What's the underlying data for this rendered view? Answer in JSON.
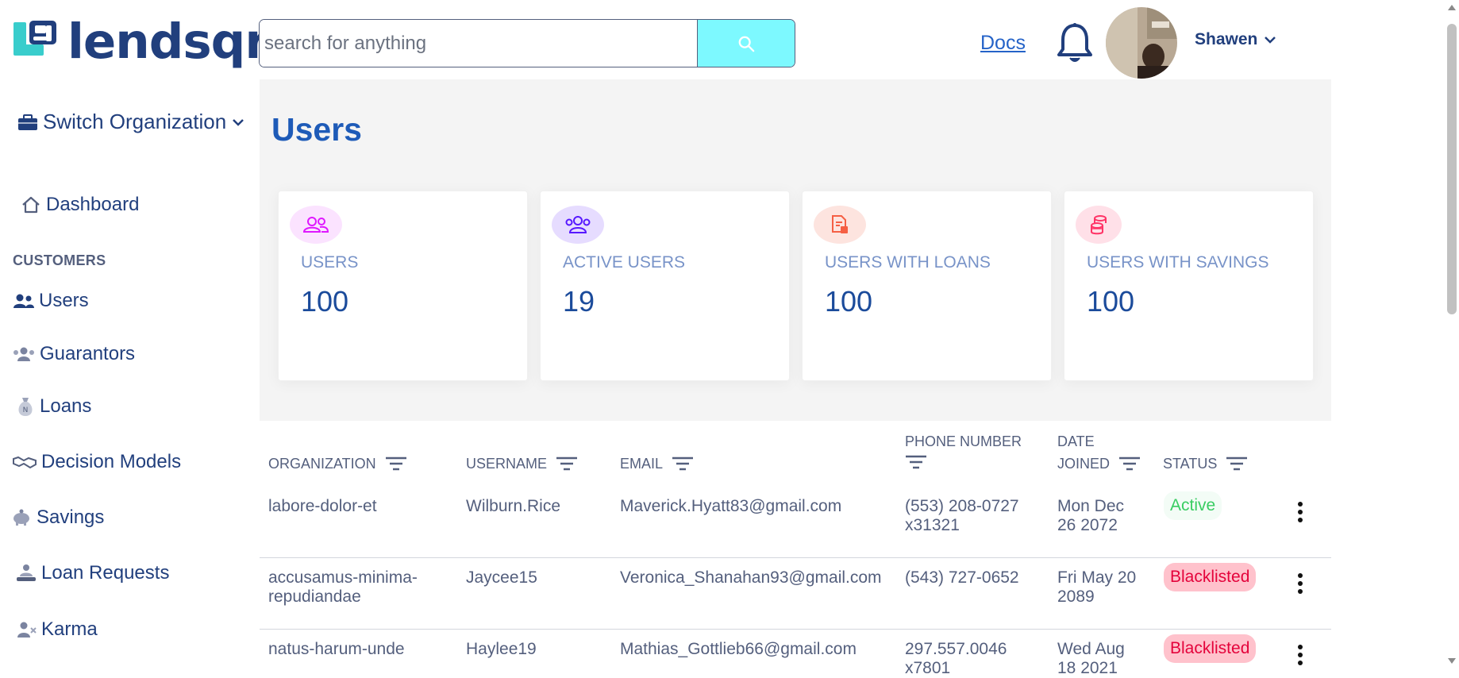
{
  "brand": {
    "name": "lendsqr"
  },
  "search": {
    "placeholder": "search for anything"
  },
  "header": {
    "docs_label": "Docs",
    "user_name": "Shawen"
  },
  "sidebar": {
    "switch_org_label": "Switch Organization",
    "dashboard_label": "Dashboard",
    "section_customers": "CUSTOMERS",
    "items": [
      {
        "label": "Users",
        "icon": "users-icon"
      },
      {
        "label": "Guarantors",
        "icon": "guarantors-icon"
      },
      {
        "label": "Loans",
        "icon": "loans-icon"
      },
      {
        "label": "Decision Models",
        "icon": "handshake-icon"
      },
      {
        "label": "Savings",
        "icon": "piggy-bank-icon"
      },
      {
        "label": "Loan Requests",
        "icon": "loan-request-icon"
      },
      {
        "label": "Karma",
        "icon": "karma-icon"
      }
    ]
  },
  "page": {
    "title": "Users"
  },
  "stats": [
    {
      "label": "USERS",
      "value": "100",
      "icon": "users-icon",
      "color": "#DF18FF"
    },
    {
      "label": "ACTIVE USERS",
      "value": "19",
      "icon": "active-users-icon",
      "color": "#5718FF"
    },
    {
      "label": "USERS WITH LOANS",
      "value": "100",
      "icon": "loans-doc-icon",
      "color": "#F55F44"
    },
    {
      "label": "USERS WITH SAVINGS",
      "value": "100",
      "icon": "coins-icon",
      "color": "#FF3366"
    }
  ],
  "table": {
    "headers": {
      "organization": "ORGANIZATION",
      "username": "USERNAME",
      "email": "EMAIL",
      "phone_line1": "PHONE NUMBER",
      "date_line1": "DATE",
      "date_line2": "JOINED",
      "status": "STATUS"
    },
    "rows": [
      {
        "org_l1": "labore-dolor-et",
        "org_l2": "",
        "username": "Wilburn.Rice",
        "email": "Maverick.Hyatt83@gmail.com",
        "phone_l1": "(553) 208-0727",
        "phone_l2": "x31321",
        "date_l1": "Mon Dec",
        "date_l2": "26 2072",
        "status": "Active"
      },
      {
        "org_l1": "accusamus-minima-",
        "org_l2": "repudiandae",
        "username": "Jaycee15",
        "email": "Veronica_Shanahan93@gmail.com",
        "phone_l1": "(543) 727-0652",
        "phone_l2": "",
        "date_l1": "Fri May 20",
        "date_l2": "2089",
        "status": "Blacklisted"
      },
      {
        "org_l1": "natus-harum-unde",
        "org_l2": "",
        "username": "Haylee19",
        "email": "Mathias_Gottlieb66@gmail.com",
        "phone_l1": "297.557.0046",
        "phone_l2": "x7801",
        "date_l1": "Wed Aug",
        "date_l2": "18 2021",
        "status": "Blacklisted"
      }
    ]
  },
  "colors": {
    "brand": "#213F7D",
    "search_button": "#7DF9FF",
    "active": "#39CD62",
    "blacklisted": "#E4033B"
  }
}
